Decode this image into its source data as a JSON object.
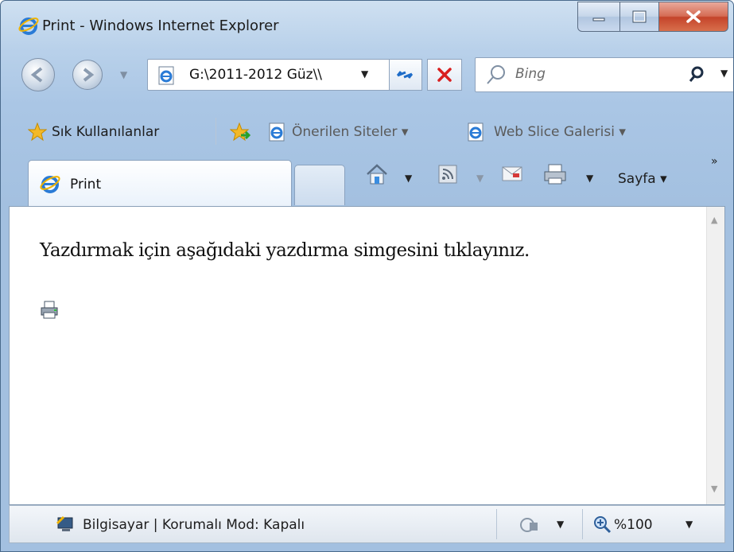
{
  "window": {
    "title": "Print - Windows Internet Explorer"
  },
  "nav": {
    "address": "G:\\2011-2012 Güz\\\\",
    "search_placeholder": "Bing"
  },
  "favorites_bar": {
    "favorites_label": "Sık Kullanılanlar",
    "suggested_sites": "Önerilen Siteler ▾",
    "web_slice": "Web Slice Galerisi ▾"
  },
  "tabs": [
    {
      "label": "Print"
    }
  ],
  "command_bar": {
    "page_menu": "Sayfa ▾",
    "overflow": "»"
  },
  "page": {
    "instruction": "Yazdırmak için aşağıdaki yazdırma simgesini tıklayınız."
  },
  "status_bar": {
    "zone_text": "Bilgisayar | Korumalı Mod: Kapalı",
    "zoom": "%100"
  },
  "icons": [
    "ie-logo-icon",
    "minimize-icon",
    "maximize-icon",
    "close-icon",
    "back-icon",
    "forward-icon",
    "refresh-icon",
    "stop-icon",
    "search-icon",
    "favorites-star-icon",
    "add-favorites-icon",
    "home-icon",
    "feeds-icon",
    "mail-icon",
    "print-icon",
    "computer-icon",
    "protected-mode-icon",
    "zoom-icon"
  ]
}
